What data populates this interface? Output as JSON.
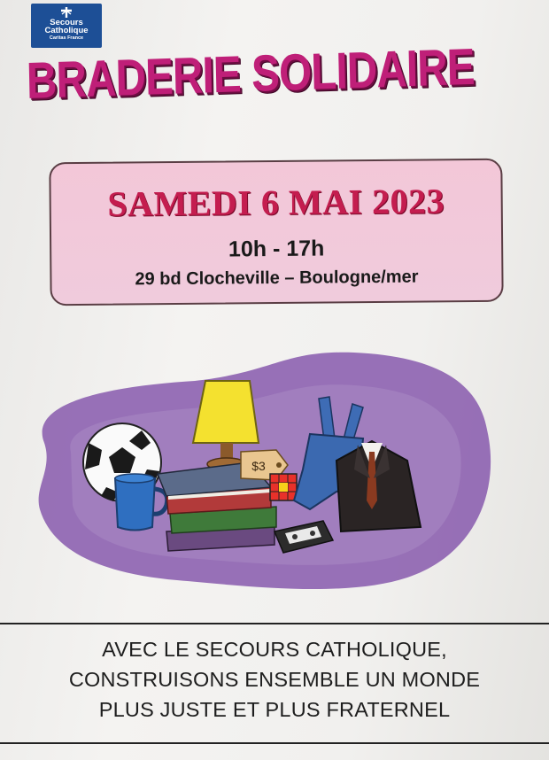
{
  "logo": {
    "line1": "Secours",
    "line2": "Catholique",
    "line3": "Caritas France"
  },
  "title": "BRADERIE SOLIDAIRE",
  "event": {
    "date": "SAMEDI 6 MAI 2023",
    "hours": "10h - 17h",
    "address": "29 bd Clocheville – Boulogne/mer"
  },
  "illustration": {
    "price_tag": "$3"
  },
  "footer": {
    "lines": [
      "AVEC LE SECOURS CATHOLIQUE,",
      "CONSTRUISONS ENSEMBLE UN MONDE",
      "PLUS JUSTE ET PLUS FRATERNEL"
    ]
  },
  "colors": {
    "title": "#bf1f78",
    "date": "#c41d4f",
    "box": "#f3c7d8",
    "blob": "#8a5fae",
    "logo": "#1d4f96"
  }
}
